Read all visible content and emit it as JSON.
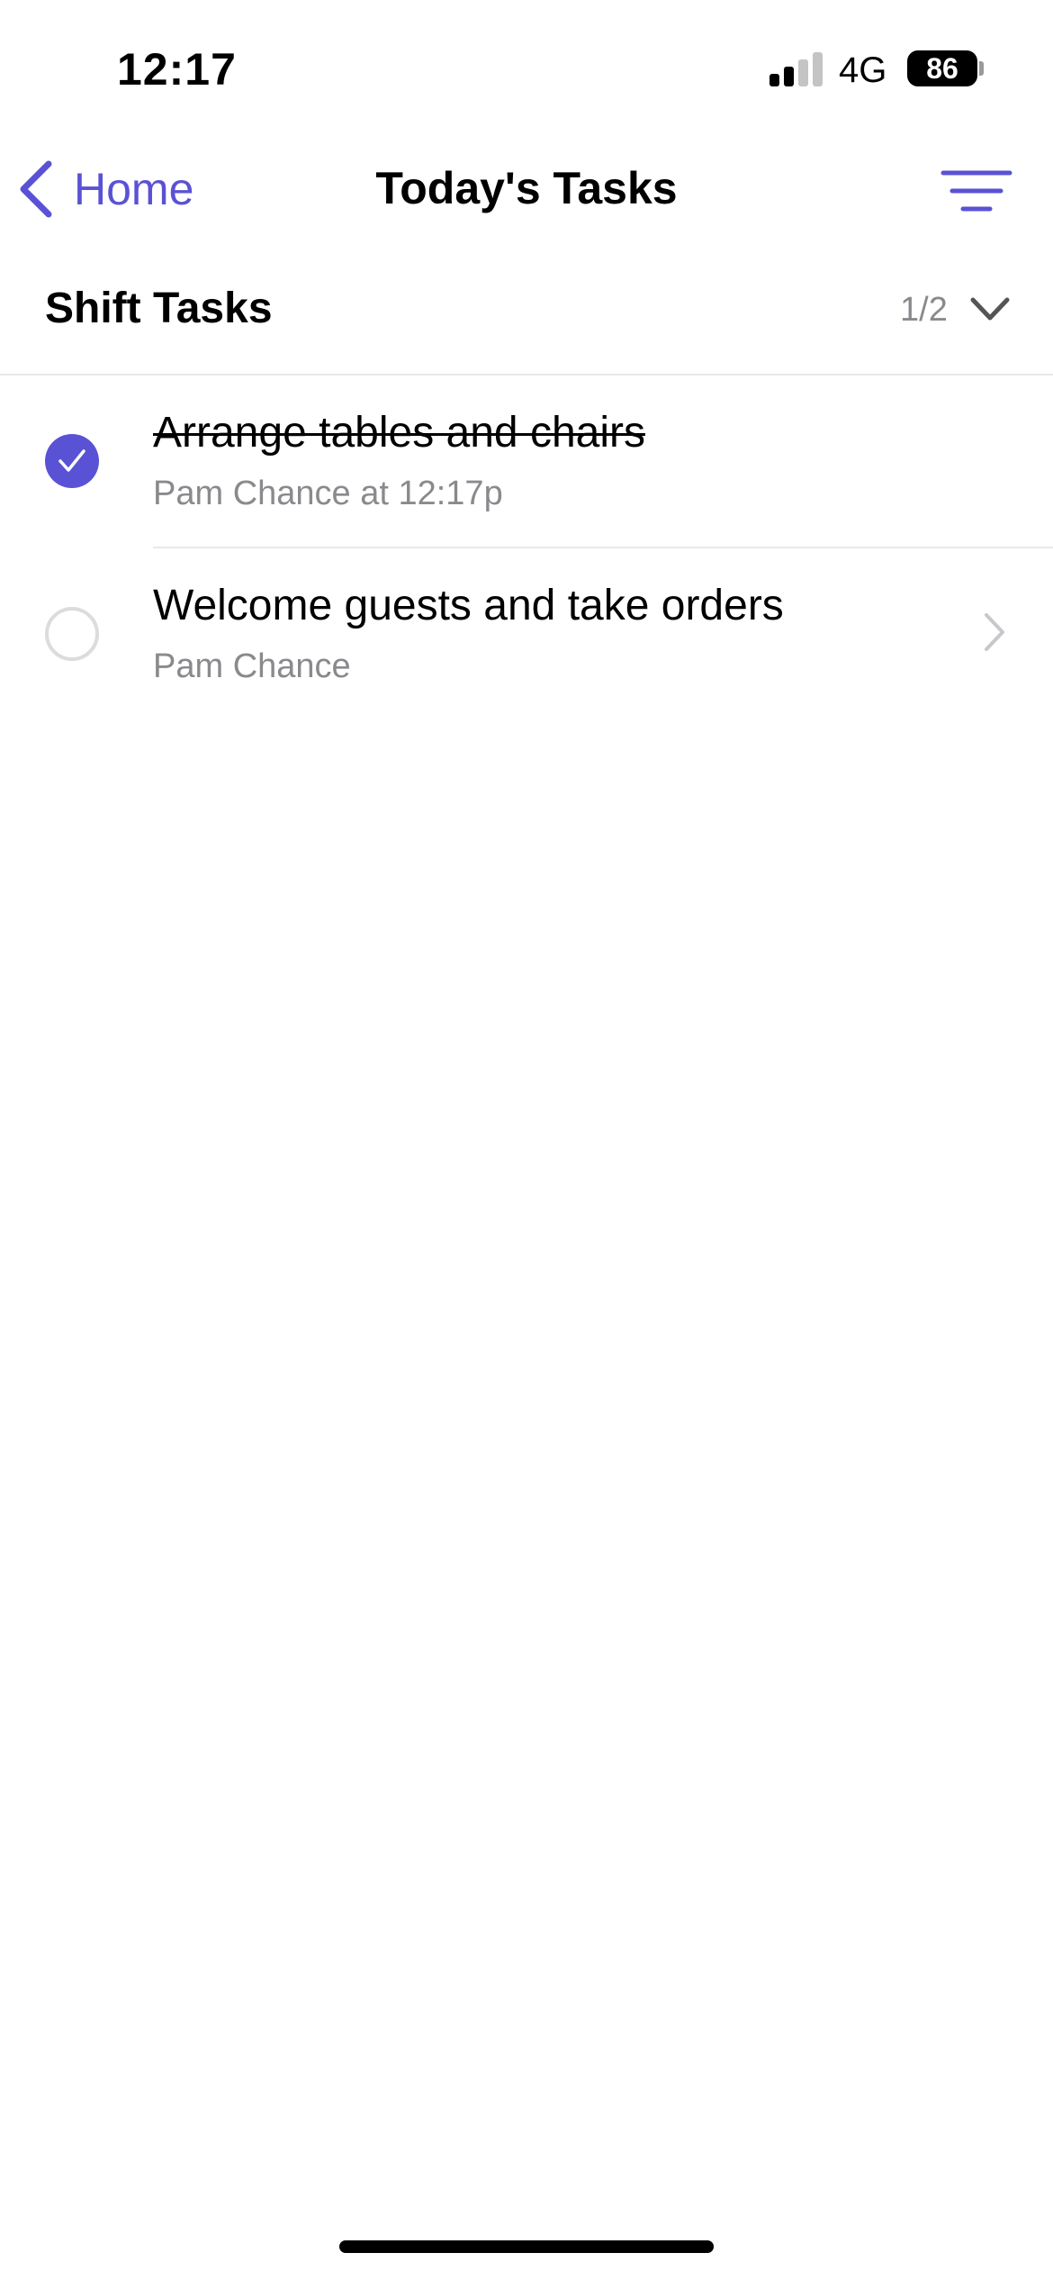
{
  "status_bar": {
    "time": "12:17",
    "network": "4G",
    "battery": "86",
    "signal_bars_active": 2,
    "signal_bars_total": 4
  },
  "nav": {
    "back_label": "Home",
    "title": "Today's Tasks",
    "back_icon": "chevron-left-icon",
    "filter_icon": "filter-lines-icon"
  },
  "section": {
    "title": "Shift Tasks",
    "count": "1/2",
    "chevron_icon": "chevron-down-icon"
  },
  "tasks": [
    {
      "title": "Arrange tables and chairs",
      "subtitle": "Pam Chance at 12:17p",
      "completed": true
    },
    {
      "title": "Welcome guests and take orders",
      "subtitle": "Pam Chance",
      "completed": false
    }
  ],
  "colors": {
    "accent": "#5a52d5",
    "secondary_text": "#8a8a8e",
    "divider": "#e8e8e8",
    "unchecked_border": "#dcdcdc"
  }
}
